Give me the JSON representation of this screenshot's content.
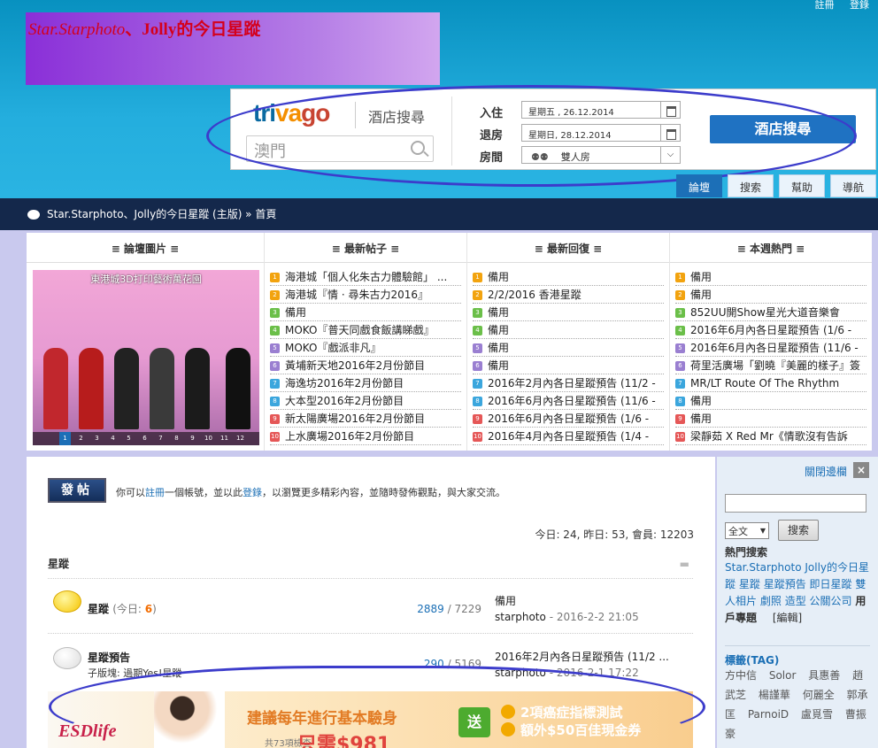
{
  "top_links": [
    "註冊",
    "登錄"
  ],
  "site_title": "、Jolly的今日星蹤",
  "site_title_prefix": "Star.Starphoto",
  "trivago": {
    "logo_a": "tri",
    "logo_b": "va",
    "logo_c": "go",
    "hotel_search": "酒店搜尋",
    "destination": "澳門",
    "checkin_label": "入住",
    "checkin_value": "星期五 , 26.12.2014",
    "checkout_label": "退房",
    "checkout_value": "星期日, 28.12.2014",
    "room_label": "房間",
    "room_value": "雙人房",
    "button": "酒店搜尋"
  },
  "nav_tabs": [
    "論壇",
    "搜索",
    "幫助",
    "導航"
  ],
  "breadcrumb": "Star.Starphoto、Jolly的今日星蹤 (主版) » 首頁",
  "portal": {
    "headers": [
      "≡ 論壇圖片 ≡",
      "≡ 最新帖子 ≡",
      "≡ 最新回復 ≡",
      "≡ 本週熱門 ≡"
    ],
    "photo_caption": "東港城3D打印藝術萬花園",
    "photo_pages": [
      "1",
      "2",
      "3",
      "4",
      "5",
      "6",
      "7",
      "8",
      "9",
      "10",
      "11",
      "12"
    ],
    "latest_posts": [
      "海港城「個人化朱古力體驗館」 ...",
      "海港城『情 · 尋朱古力2016』",
      "備用",
      "MOKO『普天同戲食飯講睇戲』",
      "MOKO『戲派非凡』",
      "黃埔新天地2016年2月份節目",
      "海逸坊2016年2月份節目",
      "大本型2016年2月份節目",
      "新太陽廣場2016年2月份節目",
      "上水廣場2016年2月份節目"
    ],
    "latest_replies": [
      "備用",
      "2/2/2016 香港星蹤",
      "備用",
      "備用",
      "備用",
      "備用",
      "2016年2月內各日星蹤預告 (11/2 -",
      "2016年6月內各日星蹤預告 (11/6 -",
      "2016年6月內各日星蹤預告 (1/6 -",
      "2016年4月內各日星蹤預告 (1/4 -"
    ],
    "weekly_hot": [
      "備用",
      "備用",
      "852UU開Show星光大道音樂會",
      "2016年6月內各日星蹤預告 (1/6 -",
      "2016年6月內各日星蹤預告 (11/6 -",
      "荷里活廣場「劉曉『美麗的樣子』簽",
      "MR/LT Route Of The Rhythm",
      "備用",
      "備用",
      "梁靜茹 X Red Mr《情歌沒有告訴"
    ]
  },
  "post": {
    "button": "發帖",
    "msg_a": "你可以",
    "msg_register": "註冊",
    "msg_b": "一個帳號，並以此",
    "msg_login": "登錄",
    "msg_c": "，以瀏覽更多精彩內容，並隨時發佈觀點，與大家交流。"
  },
  "stats": "今日: 24, 昨日: 53, 會員: 12203",
  "forum_group": "星蹤",
  "forums": [
    {
      "name": "星蹤",
      "today_label": "(今日: ",
      "today": "6",
      "today_end": ")",
      "subs": "",
      "threads": "2889",
      "posts": "7229",
      "last_title": "備用",
      "last_by": "starphoto",
      "last_time": "- 2016-2-2 21:05"
    },
    {
      "name": "星蹤預告",
      "today_label": "",
      "today": "",
      "today_end": "",
      "subs": "子版塊: 過期Yes!星蹤",
      "threads": "290",
      "posts": "5169",
      "last_title": "2016年2月內各日星蹤預告 (11/2 ...",
      "last_by": "starphoto",
      "last_time": "- 2016-2-1 17:22"
    }
  ],
  "ad": {
    "logo": "ESDlife",
    "headline": "建議每年進行基本驗身",
    "price": "只需$981",
    "sub": "共73項檢查",
    "send": "送",
    "offer1": "2項癌症指標測試",
    "offer2": "額外$50百佳現金券"
  },
  "sidebar": {
    "close": "關閉邊欄",
    "x": "×",
    "select": "全文",
    "search_btn": "搜索",
    "hot_title": "熱門搜索",
    "hot_links": [
      "Star.Starphoto",
      "Jolly的今日星蹤",
      "星蹤",
      "星蹤預告",
      "即日星蹤",
      "雙人相片",
      "劇照",
      "造型",
      "公關公司"
    ],
    "hot_plain": "用戶專題",
    "edit": "[編輯]",
    "tag_title": "標籤(TAG)",
    "tags": [
      "方中信",
      "Solor",
      "具惠善",
      "趙武芝",
      "楊謹華",
      "何麗全",
      "郭承匡",
      "ParnoiD",
      "盧覓雪",
      "曹振豪"
    ]
  },
  "colors": {
    "accent": "#1c6fb7",
    "header": "#24aede",
    "crumb": "#14284b",
    "oval": "#3c3ccb"
  }
}
